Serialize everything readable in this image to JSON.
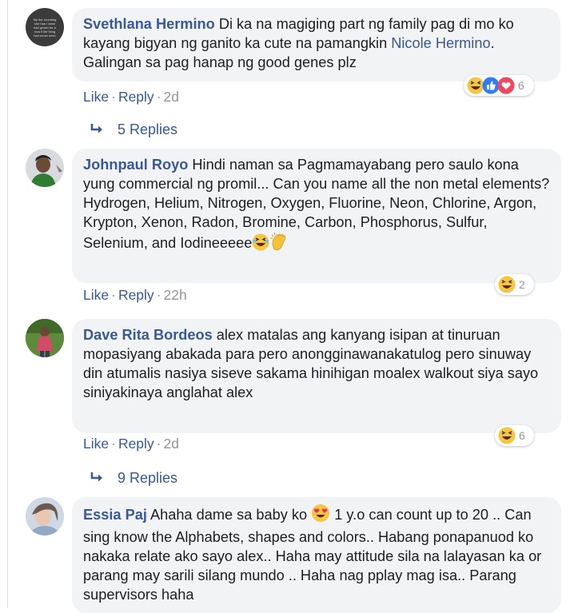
{
  "comments": [
    {
      "author": "Svethlana Hermino",
      "text_before": "Di ka na magiging part ng family pag di mo ko kayang bigyan ng ganito ka cute na pamangkin ",
      "mention": "Nicole Hermino",
      "text_after": ". Galingan sa pag hanap ng good genes plz",
      "like": "Like",
      "reply": "Reply",
      "time": "2d",
      "reaction_count": "6",
      "replies": "5 Replies",
      "avatar_text": "My the rounding she has / done had grown for a now if life thing had never seen"
    },
    {
      "author": "Johnpaul Royo",
      "text": "Hindi naman sa Pagmamayabang pero saulo kona yung commercial ng promil... Can you name all the non metal elements? Hydrogen, Helium, Nitrogen, Oxygen, Fluorine, Neon, Chlorine, Argon, Krypton, Xenon, Radon, Bromine, Carbon, Phosphorus, Sulfur, Selenium, and Iodineeeee",
      "like": "Like",
      "reply": "Reply",
      "time": "22h",
      "reaction_count": "2"
    },
    {
      "author": "Dave Rita Bordeos",
      "text": "alex matalas ang kanyang isipan at tinuruan mopasiyang abakada para pero anongginawanakatulog pero sinuway din atumalis nasiya siseve sakama hinihigan moalex walkout siya sayo siniyakinaya anglahat alex",
      "like": "Like",
      "reply": "Reply",
      "time": "2d",
      "reaction_count": "6",
      "replies": "9 Replies"
    },
    {
      "author": "Essia Paj",
      "text_before": "Ahaha dame sa baby ko ",
      "text_after": " 1 y.o can count up to 20 .. Can sing know the Alphabets, shapes and colors.. Habang ponapanuod ko nakaka relate ako sayo alex.. Haha may attitude sila na lalayasan ka or parang may sarili silang mundo .. Haha nag pplay mag isa.. Parang supervisors haha"
    }
  ],
  "separator": "·",
  "colors": {
    "link": "#385898",
    "bubble": "#f2f3f5",
    "meta": "#90949c"
  },
  "icons": [
    "haha-icon",
    "like-icon",
    "love-icon",
    "clap-icon",
    "heart-eyes-icon",
    "reply-arrow-icon"
  ]
}
